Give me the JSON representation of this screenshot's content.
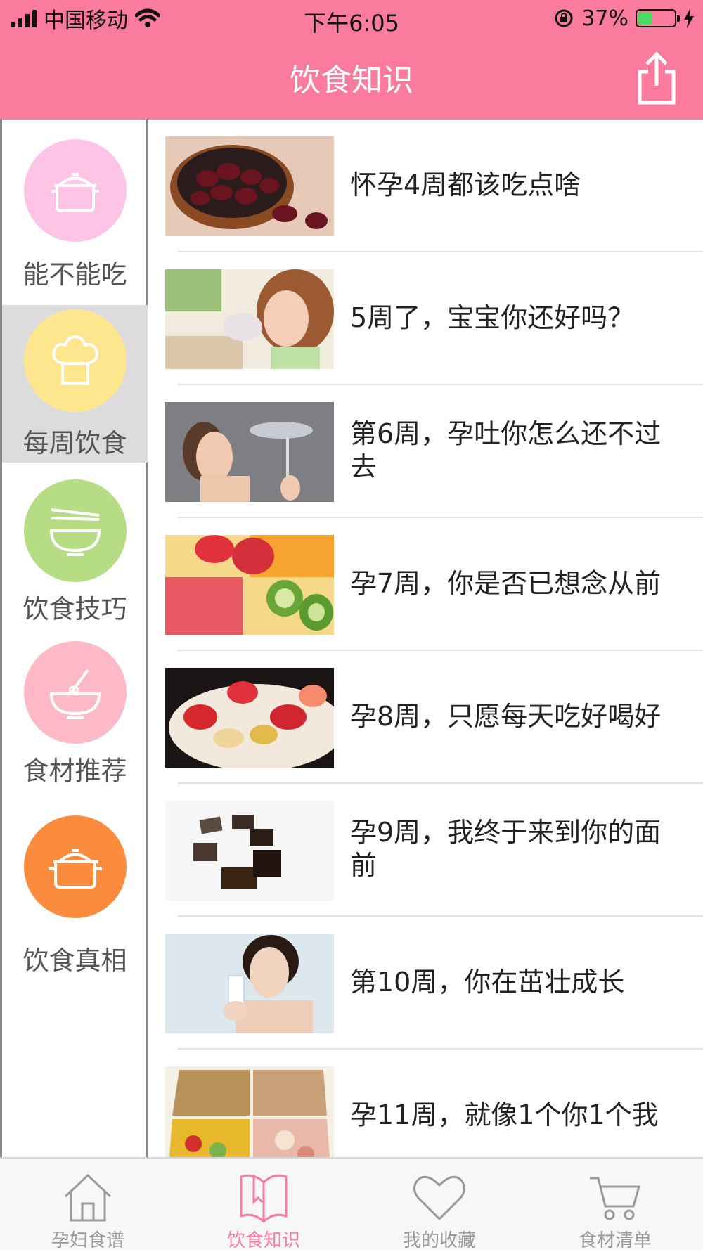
{
  "status_bar": {
    "carrier": "中国移动",
    "time": "下午6:05",
    "battery_percent": "37%",
    "battery_level": 0.37,
    "icons": [
      "signal-icon",
      "wifi-icon",
      "rotation-lock-icon",
      "battery-icon",
      "charging-icon"
    ]
  },
  "nav": {
    "title": "饮食知识",
    "share_icon": "share-icon"
  },
  "sidebar": {
    "items": [
      {
        "label": "能不能吃",
        "icon": "pot-icon",
        "color": "#fdc4e6",
        "selected": false
      },
      {
        "label": "每周饮食",
        "icon": "chef-hat-icon",
        "color": "#fde68e",
        "selected": true
      },
      {
        "label": "饮食技巧",
        "icon": "bowl-chopsticks-icon",
        "color": "#b6dc84",
        "selected": false
      },
      {
        "label": "食材推荐",
        "icon": "bowl-whisk-icon",
        "color": "#fdb9c6",
        "selected": false
      },
      {
        "label": "饮食真相",
        "icon": "pot-icon",
        "color": "#fc8c3d",
        "selected": false
      }
    ],
    "selected_bg": "#dcdcdc"
  },
  "articles": [
    {
      "title": "怀孕4周都该吃点啥",
      "thumb": "dried-dates-photo"
    },
    {
      "title": "5周了，宝宝你还好吗？",
      "thumb": "woman-eating-photo"
    },
    {
      "title": "第6周，孕吐你怎么还不过去",
      "thumb": "woman-fish-photo"
    },
    {
      "title": "孕7周，你是否已想念从前",
      "thumb": "fruit-salad-photo"
    },
    {
      "title": "孕8周，只愿每天吃好喝好",
      "thumb": "strawberry-salad-photo"
    },
    {
      "title": "孕9周，我终于来到你的面前",
      "thumb": "candy-photo"
    },
    {
      "title": "第10周，你在茁壮成长",
      "thumb": "woman-drinking-milk-photo"
    },
    {
      "title": "孕11周，就像1个你1个我",
      "thumb": "food-pyramid-photo"
    }
  ],
  "tabbar": {
    "tabs": [
      {
        "label": "孕妇食谱",
        "icon": "house-icon",
        "active": false
      },
      {
        "label": "饮食知识",
        "icon": "book-icon",
        "active": true
      },
      {
        "label": "我的收藏",
        "icon": "heart-icon",
        "active": false
      },
      {
        "label": "食材清单",
        "icon": "cart-icon",
        "active": false
      }
    ]
  },
  "colors": {
    "brand": "#fb7b9f",
    "tab_inactive": "#999999"
  }
}
